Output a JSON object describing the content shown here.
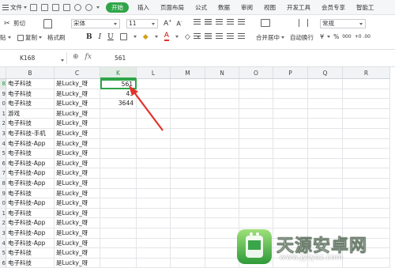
{
  "tabs": {
    "file": "文件",
    "start": "开始",
    "insert": "插入",
    "page_layout": "页面布局",
    "formula": "公式",
    "data": "数据",
    "review": "审阅",
    "view": "视图",
    "dev_tools": "开发工具",
    "member": "会员专享",
    "smart_tools": "智能工"
  },
  "ribbon": {
    "cut": "剪切",
    "paste": "贴",
    "copy": "复制",
    "format_painter": "格式刷",
    "font_name": "宋体",
    "font_size": "11",
    "bold": "B",
    "italic": "I",
    "underline": "U",
    "merge_center": "合并居中",
    "auto_wrap": "自动换行",
    "number_format": "常规",
    "percent_symbol": "%",
    "thousands_symbol": "000",
    "inc_dec": "+0 .00"
  },
  "formula_bar": {
    "name_box": "K168",
    "fx": "fx",
    "value": "561"
  },
  "grid": {
    "columns": [
      "B",
      "C",
      "K",
      "L",
      "M",
      "N",
      "O",
      "P",
      "Q",
      "R"
    ],
    "selected_column": "K",
    "rows": [
      {
        "num": "8",
        "b": "电子科技",
        "c": "是Lucky_呀",
        "k": "561",
        "selected": true
      },
      {
        "num": "9",
        "b": "电子科技",
        "c": "是Lucky_呀",
        "k": "43"
      },
      {
        "num": "0",
        "b": "电子科技",
        "c": "是Lucky_呀",
        "k": "3644"
      },
      {
        "num": "1",
        "b": "游戏",
        "c": "是Lucky_呀",
        "k": ""
      },
      {
        "num": "2",
        "b": "电子科技",
        "c": "是Lucky_呀",
        "k": ""
      },
      {
        "num": "3",
        "b": "电子科技-手机",
        "c": "是Lucky_呀",
        "k": ""
      },
      {
        "num": "4",
        "b": "电子科技-App",
        "c": "是Lucky_呀",
        "k": ""
      },
      {
        "num": "5",
        "b": "电子科技",
        "c": "是Lucky_呀",
        "k": ""
      },
      {
        "num": "6",
        "b": "电子科技-App",
        "c": "是Lucky_呀",
        "k": ""
      },
      {
        "num": "7",
        "b": "电子科技-App",
        "c": "是Lucky_呀",
        "k": ""
      },
      {
        "num": "8",
        "b": "电子科技-App",
        "c": "是Lucky_呀",
        "k": ""
      },
      {
        "num": "9",
        "b": "电子科技",
        "c": "是Lucky_呀",
        "k": ""
      },
      {
        "num": "0",
        "b": "电子科技-App",
        "c": "是Lucky_呀",
        "k": ""
      },
      {
        "num": "1",
        "b": "电子科技",
        "c": "是Lucky_呀",
        "k": ""
      },
      {
        "num": "2",
        "b": "电子科技-App",
        "c": "是Lucky_呀",
        "k": ""
      },
      {
        "num": "3",
        "b": "电子科技-App",
        "c": "是Lucky_呀",
        "k": ""
      },
      {
        "num": "4",
        "b": "电子科技-App",
        "c": "是Lucky_呀",
        "k": ""
      },
      {
        "num": "5",
        "b": "电子科技",
        "c": "是Lucky_呀",
        "k": ""
      },
      {
        "num": "6",
        "b": "电子科技",
        "c": "是Lucky_呀",
        "k": ""
      },
      {
        "num": "7",
        "b": "电子科技-App",
        "c": "是Lucky_呀",
        "k": ""
      }
    ]
  },
  "watermark": {
    "name": "天源安卓网",
    "url": "www.jytyaz.com"
  },
  "colors": {
    "accent": "#2fa548",
    "annotation_arrow": "#e0332b"
  }
}
